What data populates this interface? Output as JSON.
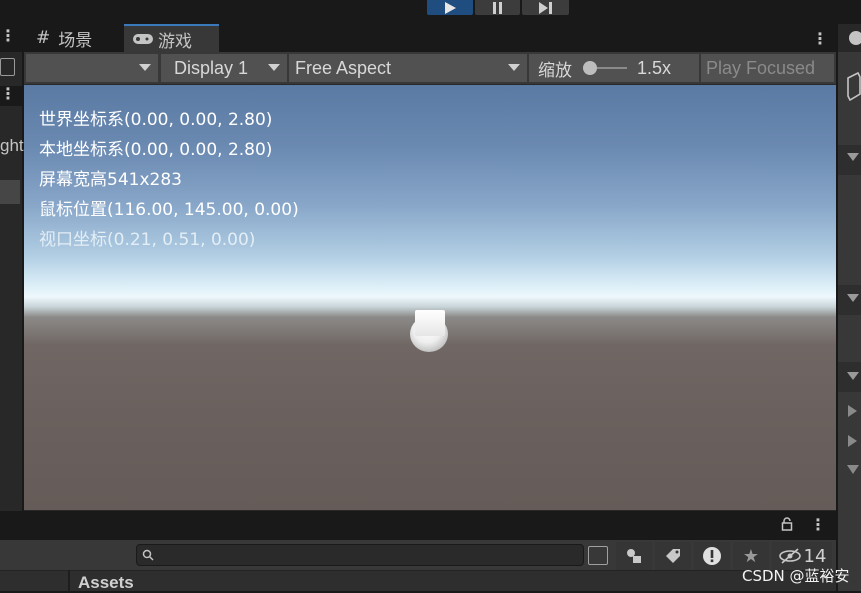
{
  "toolbar": {
    "play_icon": "play-icon",
    "pause_icon": "pause-icon",
    "step_icon": "step-icon"
  },
  "tabs": [
    {
      "label": "场景",
      "icon": "grid-icon"
    },
    {
      "label": "游戏",
      "icon": "gamepad-icon",
      "active": true
    }
  ],
  "game_toolbar": {
    "display": "Display 1",
    "aspect": "Free Aspect",
    "scale_label": "缩放",
    "scale_value": "1.5x",
    "play_mode": "Play Focused"
  },
  "overlay": {
    "world": "世界坐标系(0.00, 0.00, 2.80)",
    "local": "本地坐标系(0.00, 0.00, 2.80)",
    "screen": "屏幕宽高541x283",
    "mouse": "鼠标位置(116.00, 145.00, 0.00)",
    "viewport": "视口坐标(0.21, 0.51, 0.00)"
  },
  "left_panel": {
    "cut_text": "ght"
  },
  "bottom": {
    "search_placeholder": "",
    "hidden_count": "14",
    "assets_label": "Assets"
  },
  "watermark": "CSDN @蓝裕安",
  "colors": {
    "accent": "#3a79bb",
    "play_active": "#1f4d80",
    "sky_top": "#5b7aa3",
    "ground": "#6a605d"
  }
}
